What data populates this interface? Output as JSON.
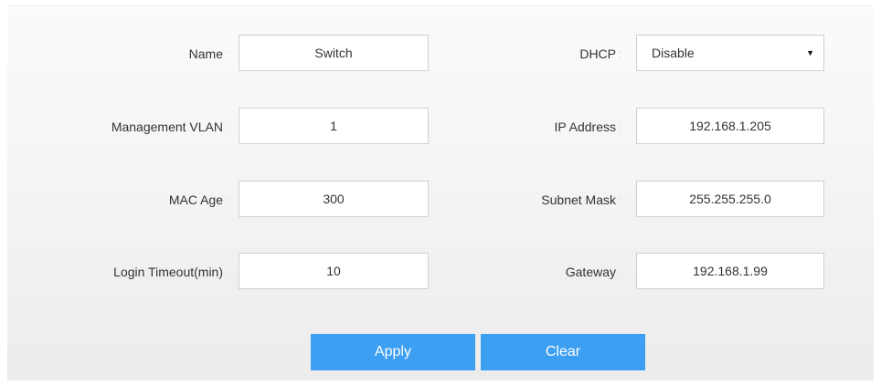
{
  "form": {
    "rows": [
      {
        "left": {
          "label": "Name",
          "value": "Switch"
        },
        "right": {
          "label": "DHCP",
          "value": "Disable",
          "type": "select"
        }
      },
      {
        "left": {
          "label": "Management VLAN",
          "value": "1"
        },
        "right": {
          "label": "IP Address",
          "value": "192.168.1.205"
        }
      },
      {
        "left": {
          "label": "MAC Age",
          "value": "300"
        },
        "right": {
          "label": "Subnet Mask",
          "value": "255.255.255.0"
        }
      },
      {
        "left": {
          "label": "Login Timeout(min)",
          "value": "10"
        },
        "right": {
          "label": "Gateway",
          "value": "192.168.1.99"
        }
      }
    ],
    "colon": ":",
    "dropdown_icon": "▼"
  },
  "actions": {
    "apply_label": "Apply",
    "clear_label": "Clear"
  },
  "colors": {
    "button": "#3d9ff2",
    "button_text": "#ffffff",
    "label_text": "#333333"
  }
}
